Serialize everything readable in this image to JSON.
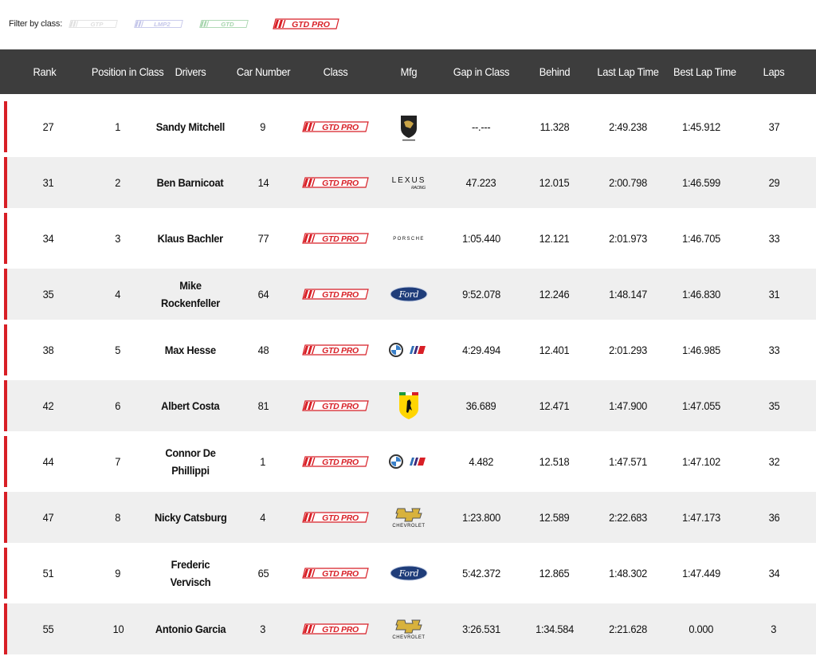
{
  "filter": {
    "label": "Filter by class:",
    "options": [
      {
        "label": "GTP",
        "active": false,
        "color": "#b9b9b9"
      },
      {
        "label": "LMP2",
        "active": false,
        "color": "#7b7fd0"
      },
      {
        "label": "GTD",
        "active": false,
        "color": "#3aa24a"
      },
      {
        "label": "GTD PRO",
        "active": true,
        "color": "#d81f26"
      }
    ]
  },
  "columns": [
    "Rank",
    "Position in Class",
    "Drivers",
    "Car Number",
    "Class",
    "Mfg",
    "Gap in Class",
    "Behind",
    "Last Lap Time",
    "Best Lap Time",
    "Laps"
  ],
  "colors": {
    "accent": "#d81f26",
    "header_bg": "#3d3d3d",
    "row_alt": "#efefef"
  },
  "class_badge": "GTD PRO",
  "rows": [
    {
      "rank": "27",
      "pos": "1",
      "driver": "Sandy Mitchell",
      "car": "9",
      "mfg": "lamborghini-logo",
      "gap": "--.---",
      "behind": "11.328",
      "last": "2:49.238",
      "best": "1:45.912",
      "laps": "37"
    },
    {
      "rank": "31",
      "pos": "2",
      "driver": "Ben Barnicoat",
      "car": "14",
      "mfg": "lexus-logo",
      "gap": "47.223",
      "behind": "12.015",
      "last": "2:00.798",
      "best": "1:46.599",
      "laps": "29"
    },
    {
      "rank": "34",
      "pos": "3",
      "driver": "Klaus Bachler",
      "car": "77",
      "mfg": "porsche-logo",
      "gap": "1:05.440",
      "behind": "12.121",
      "last": "2:01.973",
      "best": "1:46.705",
      "laps": "33"
    },
    {
      "rank": "35",
      "pos": "4",
      "driver": "Mike Rockenfeller",
      "car": "64",
      "mfg": "ford-logo",
      "gap": "9:52.078",
      "behind": "12.246",
      "last": "1:48.147",
      "best": "1:46.830",
      "laps": "31"
    },
    {
      "rank": "38",
      "pos": "5",
      "driver": "Max Hesse",
      "car": "48",
      "mfg": "bmw-logo",
      "gap": "4:29.494",
      "behind": "12.401",
      "last": "2:01.293",
      "best": "1:46.985",
      "laps": "33"
    },
    {
      "rank": "42",
      "pos": "6",
      "driver": "Albert Costa",
      "car": "81",
      "mfg": "ferrari-logo",
      "gap": "36.689",
      "behind": "12.471",
      "last": "1:47.900",
      "best": "1:47.055",
      "laps": "35"
    },
    {
      "rank": "44",
      "pos": "7",
      "driver": "Connor De Phillippi",
      "car": "1",
      "mfg": "bmw-logo",
      "gap": "4.482",
      "behind": "12.518",
      "last": "1:47.571",
      "best": "1:47.102",
      "laps": "32"
    },
    {
      "rank": "47",
      "pos": "8",
      "driver": "Nicky Catsburg",
      "car": "4",
      "mfg": "chevrolet-logo",
      "gap": "1:23.800",
      "behind": "12.589",
      "last": "2:22.683",
      "best": "1:47.173",
      "laps": "36"
    },
    {
      "rank": "51",
      "pos": "9",
      "driver": "Frederic Vervisch",
      "car": "65",
      "mfg": "ford-logo",
      "gap": "5:42.372",
      "behind": "12.865",
      "last": "1:48.302",
      "best": "1:47.449",
      "laps": "34"
    },
    {
      "rank": "55",
      "pos": "10",
      "driver": "Antonio Garcia",
      "car": "3",
      "mfg": "chevrolet-logo",
      "gap": "3:26.531",
      "behind": "1:34.584",
      "last": "2:21.628",
      "best": "0.000",
      "laps": "3"
    }
  ],
  "logo_text": {
    "lexus": "LEXUS",
    "lexus_sub": "RACING",
    "porsche": "PORSCHE",
    "ford": "Ford",
    "chevrolet": "CHEVROLET"
  }
}
